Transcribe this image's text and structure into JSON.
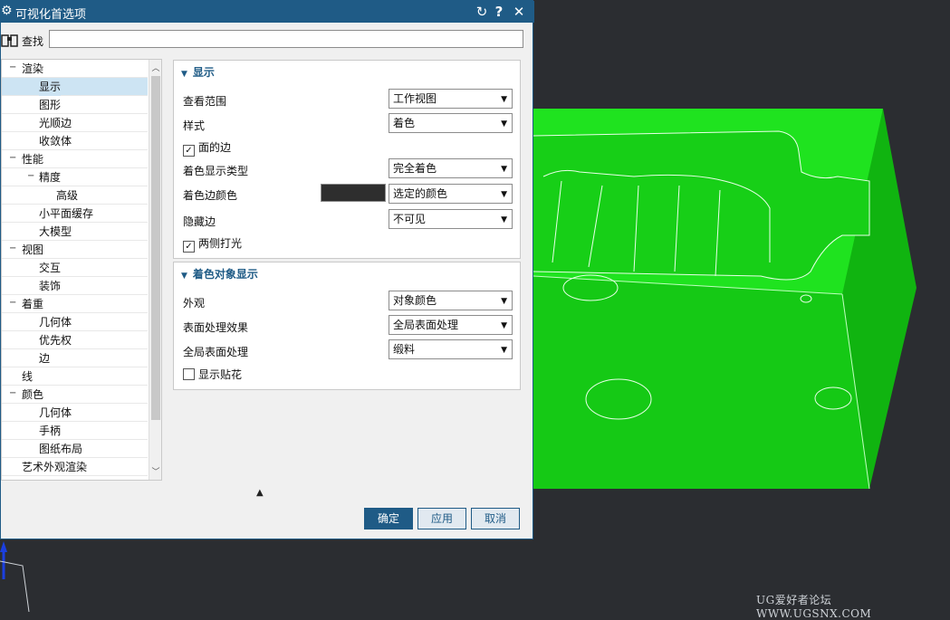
{
  "dialog": {
    "title": "可视化首选项",
    "buttons": {
      "reset_icon": "reset-icon",
      "help": "?",
      "close": "✕"
    }
  },
  "find": {
    "label": "查找",
    "value": ""
  },
  "tree": {
    "items": [
      {
        "label": "渲染",
        "expander": "−"
      },
      {
        "label": "显示",
        "selected": true
      },
      {
        "label": "图形"
      },
      {
        "label": "光顺边"
      },
      {
        "label": "收敛体"
      },
      {
        "label": "性能",
        "expander": "−"
      },
      {
        "label": "精度",
        "expander": "−"
      },
      {
        "label": "高级"
      },
      {
        "label": "小平面缓存"
      },
      {
        "label": "大模型"
      },
      {
        "label": "视图",
        "expander": "−"
      },
      {
        "label": "交互"
      },
      {
        "label": "装饰"
      },
      {
        "label": "着重",
        "expander": "−"
      },
      {
        "label": "几何体"
      },
      {
        "label": "优先权"
      },
      {
        "label": "边"
      },
      {
        "label": "线"
      },
      {
        "label": "颜色",
        "expander": "−"
      },
      {
        "label": "几何体"
      },
      {
        "label": "手柄"
      },
      {
        "label": "图纸布局"
      },
      {
        "label": "艺术外观渲染"
      }
    ]
  },
  "display_panel": {
    "title": "显示",
    "view_range_label": "查看范围",
    "view_range_value": "工作视图",
    "style_label": "样式",
    "style_value": "着色",
    "face_edges_label": "面的边",
    "face_edges_checked": true,
    "shade_type_label": "着色显示类型",
    "shade_type_value": "完全着色",
    "shade_edge_color_label": "着色边颜色",
    "shade_edge_color_value": "选定的颜色",
    "shade_edge_color_swatch": "#2e2e2e",
    "hidden_edges_label": "隐藏边",
    "hidden_edges_value": "不可见",
    "two_side_light_label": "两侧打光",
    "two_side_light_checked": true
  },
  "shaded_panel": {
    "title": "着色对象显示",
    "appearance_label": "外观",
    "appearance_value": "对象颜色",
    "surface_effect_label": "表面处理效果",
    "surface_effect_value": "全局表面处理",
    "global_surface_label": "全局表面处理",
    "global_surface_value": "缎料",
    "show_decal_label": "显示贴花",
    "show_decal_checked": false
  },
  "footer": {
    "ok": "确定",
    "apply": "应用",
    "cancel": "取消"
  },
  "watermark": "UG爱好者论坛 WWW.UGSNX.COM",
  "colors": {
    "accent": "#1f5b86",
    "model_green": "#18d418",
    "background": "#2b2d31",
    "annotation_red": "#d81e1e"
  }
}
